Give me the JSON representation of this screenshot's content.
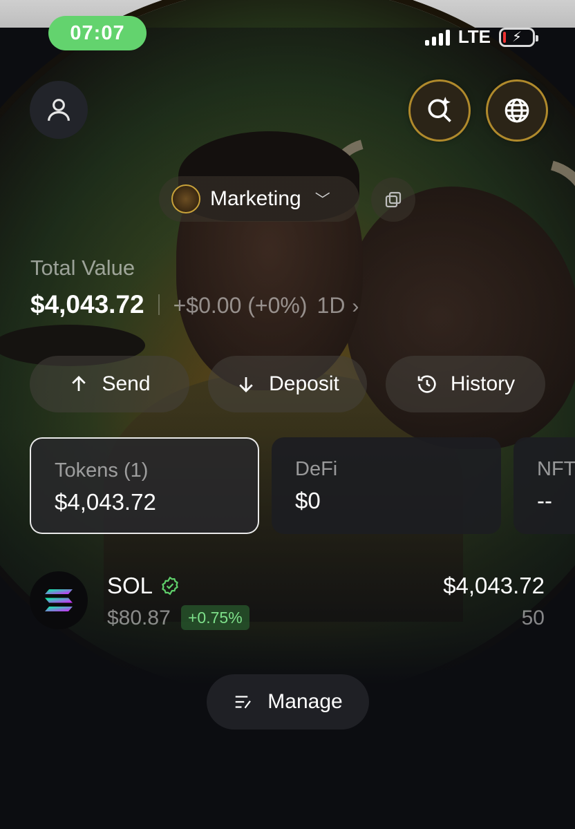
{
  "status_bar": {
    "time": "07:07",
    "network": "LTE",
    "battery_level": 0.1,
    "time_pill_color": "#63d36e"
  },
  "header": {
    "avatar_icon": "user-icon",
    "search_icon": "sparkle-search-icon",
    "globe_icon": "globe-icon"
  },
  "account": {
    "name": "Marketing",
    "avatar_icon": "account-avatar-icon",
    "copy_icon": "copy-icon"
  },
  "portfolio": {
    "total_label": "Total Value",
    "total_value": "$4,043.72",
    "change": "+$0.00 (+0%)",
    "period": "1D"
  },
  "actions": [
    {
      "label": "Send",
      "icon": "arrow-up-icon"
    },
    {
      "label": "Deposit",
      "icon": "arrow-down-icon"
    },
    {
      "label": "History",
      "icon": "history-icon"
    }
  ],
  "cards": [
    {
      "label": "Tokens (1)",
      "value": "$4,043.72",
      "active": true
    },
    {
      "label": "DeFi",
      "value": "$0",
      "active": false
    },
    {
      "label": "NFT",
      "value": "--",
      "active": false
    }
  ],
  "tokens": [
    {
      "symbol": "SOL",
      "price": "$80.87",
      "change": "+0.75%",
      "value": "$4,043.72",
      "quantity": "50",
      "verified": true
    }
  ],
  "manage_label": "Manage",
  "colors": {
    "accent_gold": "#c9a23a",
    "positive_green": "#7ee08a",
    "background": "#0c0d11"
  }
}
